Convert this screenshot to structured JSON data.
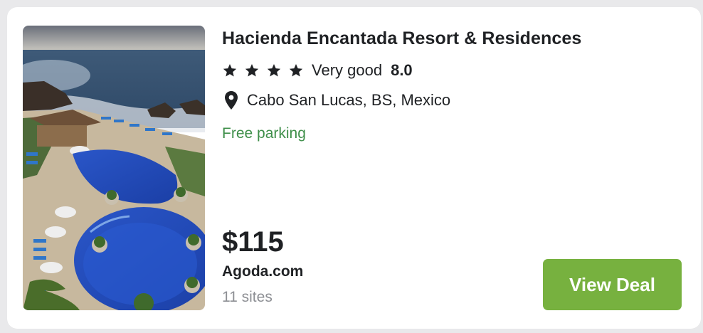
{
  "hotel": {
    "name": "Hacienda Encantada Resort & Residences",
    "star_count": 4,
    "rating_label": "Very good",
    "rating_score": "8.0",
    "location": "Cabo San Lucas, BS, Mexico",
    "amenity": "Free parking",
    "photo_icon": "hotel-photo"
  },
  "offer": {
    "price": "$115",
    "provider": "Agoda.com",
    "sites": "11 sites",
    "cta_label": "View Deal"
  },
  "colors": {
    "accent_green": "#77b13f",
    "amenity_green": "#3f8f4a",
    "text_dark": "#1f2124",
    "text_muted": "#8d8f94"
  }
}
